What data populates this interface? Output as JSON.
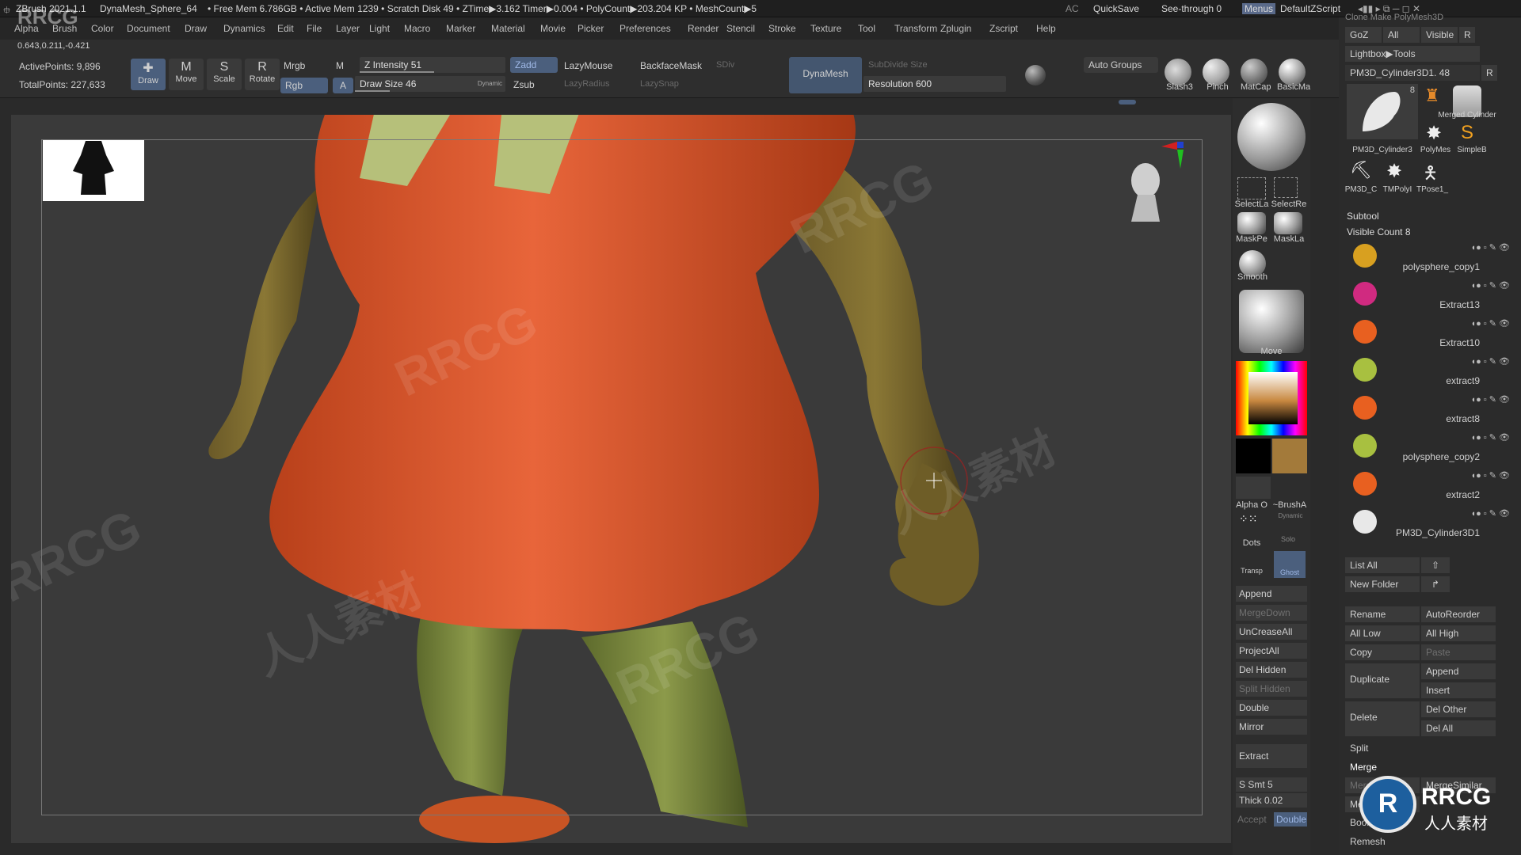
{
  "title_bar": {
    "app": "ZBrush 2021.1.1",
    "document": "DynaMesh_Sphere_64",
    "stats": "• Free Mem 6.786GB • Active Mem 1239 • Scratch Disk 49 • ZTime▶3.162 Timer▶0.004 • PolyCount▶203.204 KP • MeshCount▶5",
    "ac": "AC",
    "quicksave": "QuickSave",
    "see_through": "See-through 0",
    "menus": "Menus",
    "script": "DefaultZScript"
  },
  "menu": [
    "Alpha",
    "Brush",
    "Color",
    "Document",
    "Draw",
    "Dynamics",
    "Edit",
    "File",
    "Layer",
    "Light",
    "Macro",
    "Marker",
    "Material",
    "Movie",
    "Picker",
    "Preferences",
    "Render",
    "Stencil",
    "Stroke",
    "Texture",
    "Tool",
    "Transform",
    "Zplugin",
    "Zscript",
    "Help"
  ],
  "toolbar": {
    "coords": "0.643,0.211,-0.421",
    "active_points": "ActivePoints: 9,896",
    "total_points": "TotalPoints: 227,633",
    "modes": [
      "Draw",
      "Move",
      "Scale",
      "Rotate"
    ],
    "mrgb": "Mrgb",
    "rgb": "Rgb",
    "m": "M",
    "a": "A",
    "z_intensity": "Z Intensity 51",
    "z_intensity_value": 51,
    "draw_size": "Draw Size 46",
    "draw_size_value": 46,
    "dynamic": "Dynamic",
    "zadd": "Zadd",
    "zsub": "Zsub",
    "lazymouse": "LazyMouse",
    "lazyradius": "LazyRadius",
    "backfacemask": "BackfaceMask",
    "lazysnap": "LazySnap",
    "sdiv": "SDiv",
    "dynamesh": "DynaMesh",
    "subdivide_size": "SubDivide Size",
    "resolution": "Resolution 600",
    "auto_groups": "Auto Groups",
    "brush_shelf": [
      "Slash3",
      "Pinch",
      "MatCap",
      "BasicMa"
    ]
  },
  "right_shelf": {
    "select_lasso": "SelectLa",
    "select_rect": "SelectRe",
    "mask_pen": "MaskPe",
    "mask_lasso": "MaskLa",
    "smooth": "Smooth",
    "move": "Move",
    "alpha": "Alpha O",
    "brush_alpha": "~BrushA",
    "dynamic": "Dynamic",
    "dots": "Dots",
    "solo": "Solo",
    "transp": "Transp",
    "ghost": "Ghost",
    "buttons": [
      "Append",
      "MergeDown",
      "UnCreaseAll",
      "ProjectAll",
      "Del Hidden",
      "Split Hidden",
      "Double",
      "Mirror",
      "Extract"
    ],
    "s_smt": "S Smt 5",
    "thick": "Thick 0.02",
    "accept": "Accept",
    "double2": "Double"
  },
  "tool_panel": {
    "top_clipped": "Clone  Make PolyMesh3D",
    "goz": "GoZ",
    "all": "All",
    "visible": "Visible",
    "r": "R",
    "lightbox_tools": "Lightbox▶Tools",
    "current_tool": "PM3D_Cylinder3D1. 48",
    "r2": "R",
    "thumb_count": "8",
    "thumbs": [
      "PM3D_Cylinder3",
      "PolyMes",
      "SimpleB",
      "PM3D_C",
      "TMPolyI",
      "TPose1_"
    ],
    "merged_cylinder": "Merged Cylinder",
    "subtool_header": "Subtool",
    "visible_count": "Visible Count 8",
    "subtools": [
      "polysphere_copy1",
      "Extract13",
      "Extract10",
      "extract9",
      "extract8",
      "polysphere_copy2",
      "extract2",
      "PM3D_Cylinder3D1"
    ],
    "list_all": "List All",
    "new_folder": "New Folder",
    "buttons": {
      "rename": "Rename",
      "autoreorder": "AutoReorder",
      "all_low": "All Low",
      "all_high": "All High",
      "copy": "Copy",
      "paste": "Paste",
      "duplicate": "Duplicate",
      "append": "Append",
      "insert": "Insert",
      "delete": "Delete",
      "del_other": "Del Other",
      "del_all": "Del All",
      "split": "Split",
      "merge": "Merge",
      "merge_similar": "MergeSimilar",
      "merge_down": "MergeDown",
      "merge_visible": "MergeVisible",
      "boolean": "Boolean",
      "remesh": "Remesh"
    }
  },
  "watermark": "RRCG",
  "watermark_cn": "人人素材",
  "logo_text": "RRCG",
  "logo_cn": "人人素材"
}
